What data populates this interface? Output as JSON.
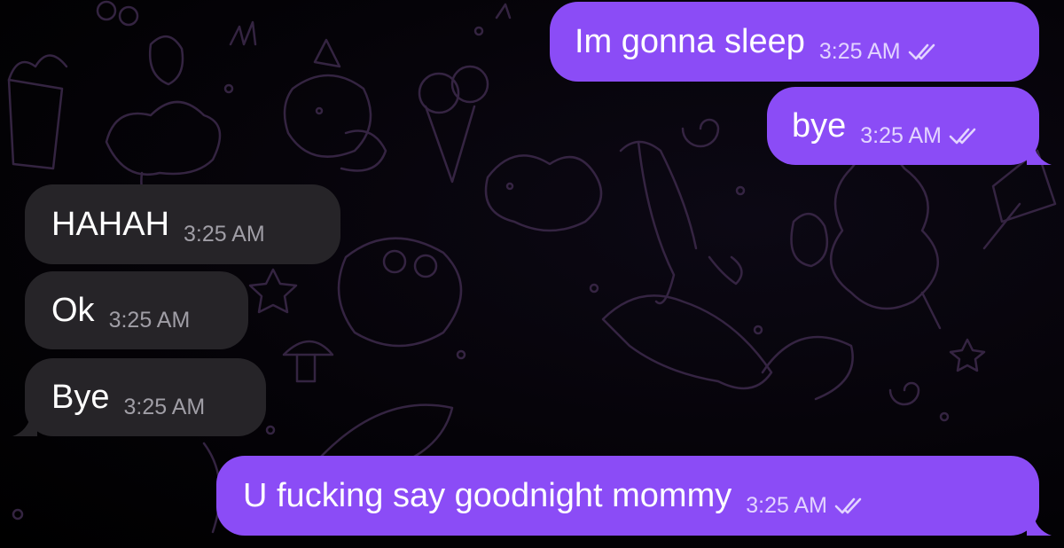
{
  "chat": {
    "messages": [
      {
        "text": "Im gonna sleep",
        "time": "3:25 AM",
        "direction": "outgoing",
        "status": "read"
      },
      {
        "text": "bye",
        "time": "3:25 AM",
        "direction": "outgoing",
        "status": "read"
      },
      {
        "text": "HAHAH",
        "time": "3:25 AM",
        "direction": "incoming"
      },
      {
        "text": "Ok",
        "time": "3:25 AM",
        "direction": "incoming"
      },
      {
        "text": "Bye",
        "time": "3:25 AM",
        "direction": "incoming"
      },
      {
        "text": "U fucking say goodnight mommy",
        "time": "3:25 AM",
        "direction": "outgoing",
        "status": "read"
      }
    ]
  },
  "colors": {
    "outgoing_bubble": "#8b4cf6",
    "incoming_bubble": "#262428",
    "background": "#000000",
    "doodle_stroke": "#4a2f5c"
  },
  "icons": {
    "read_receipt": "double-check-icon"
  }
}
